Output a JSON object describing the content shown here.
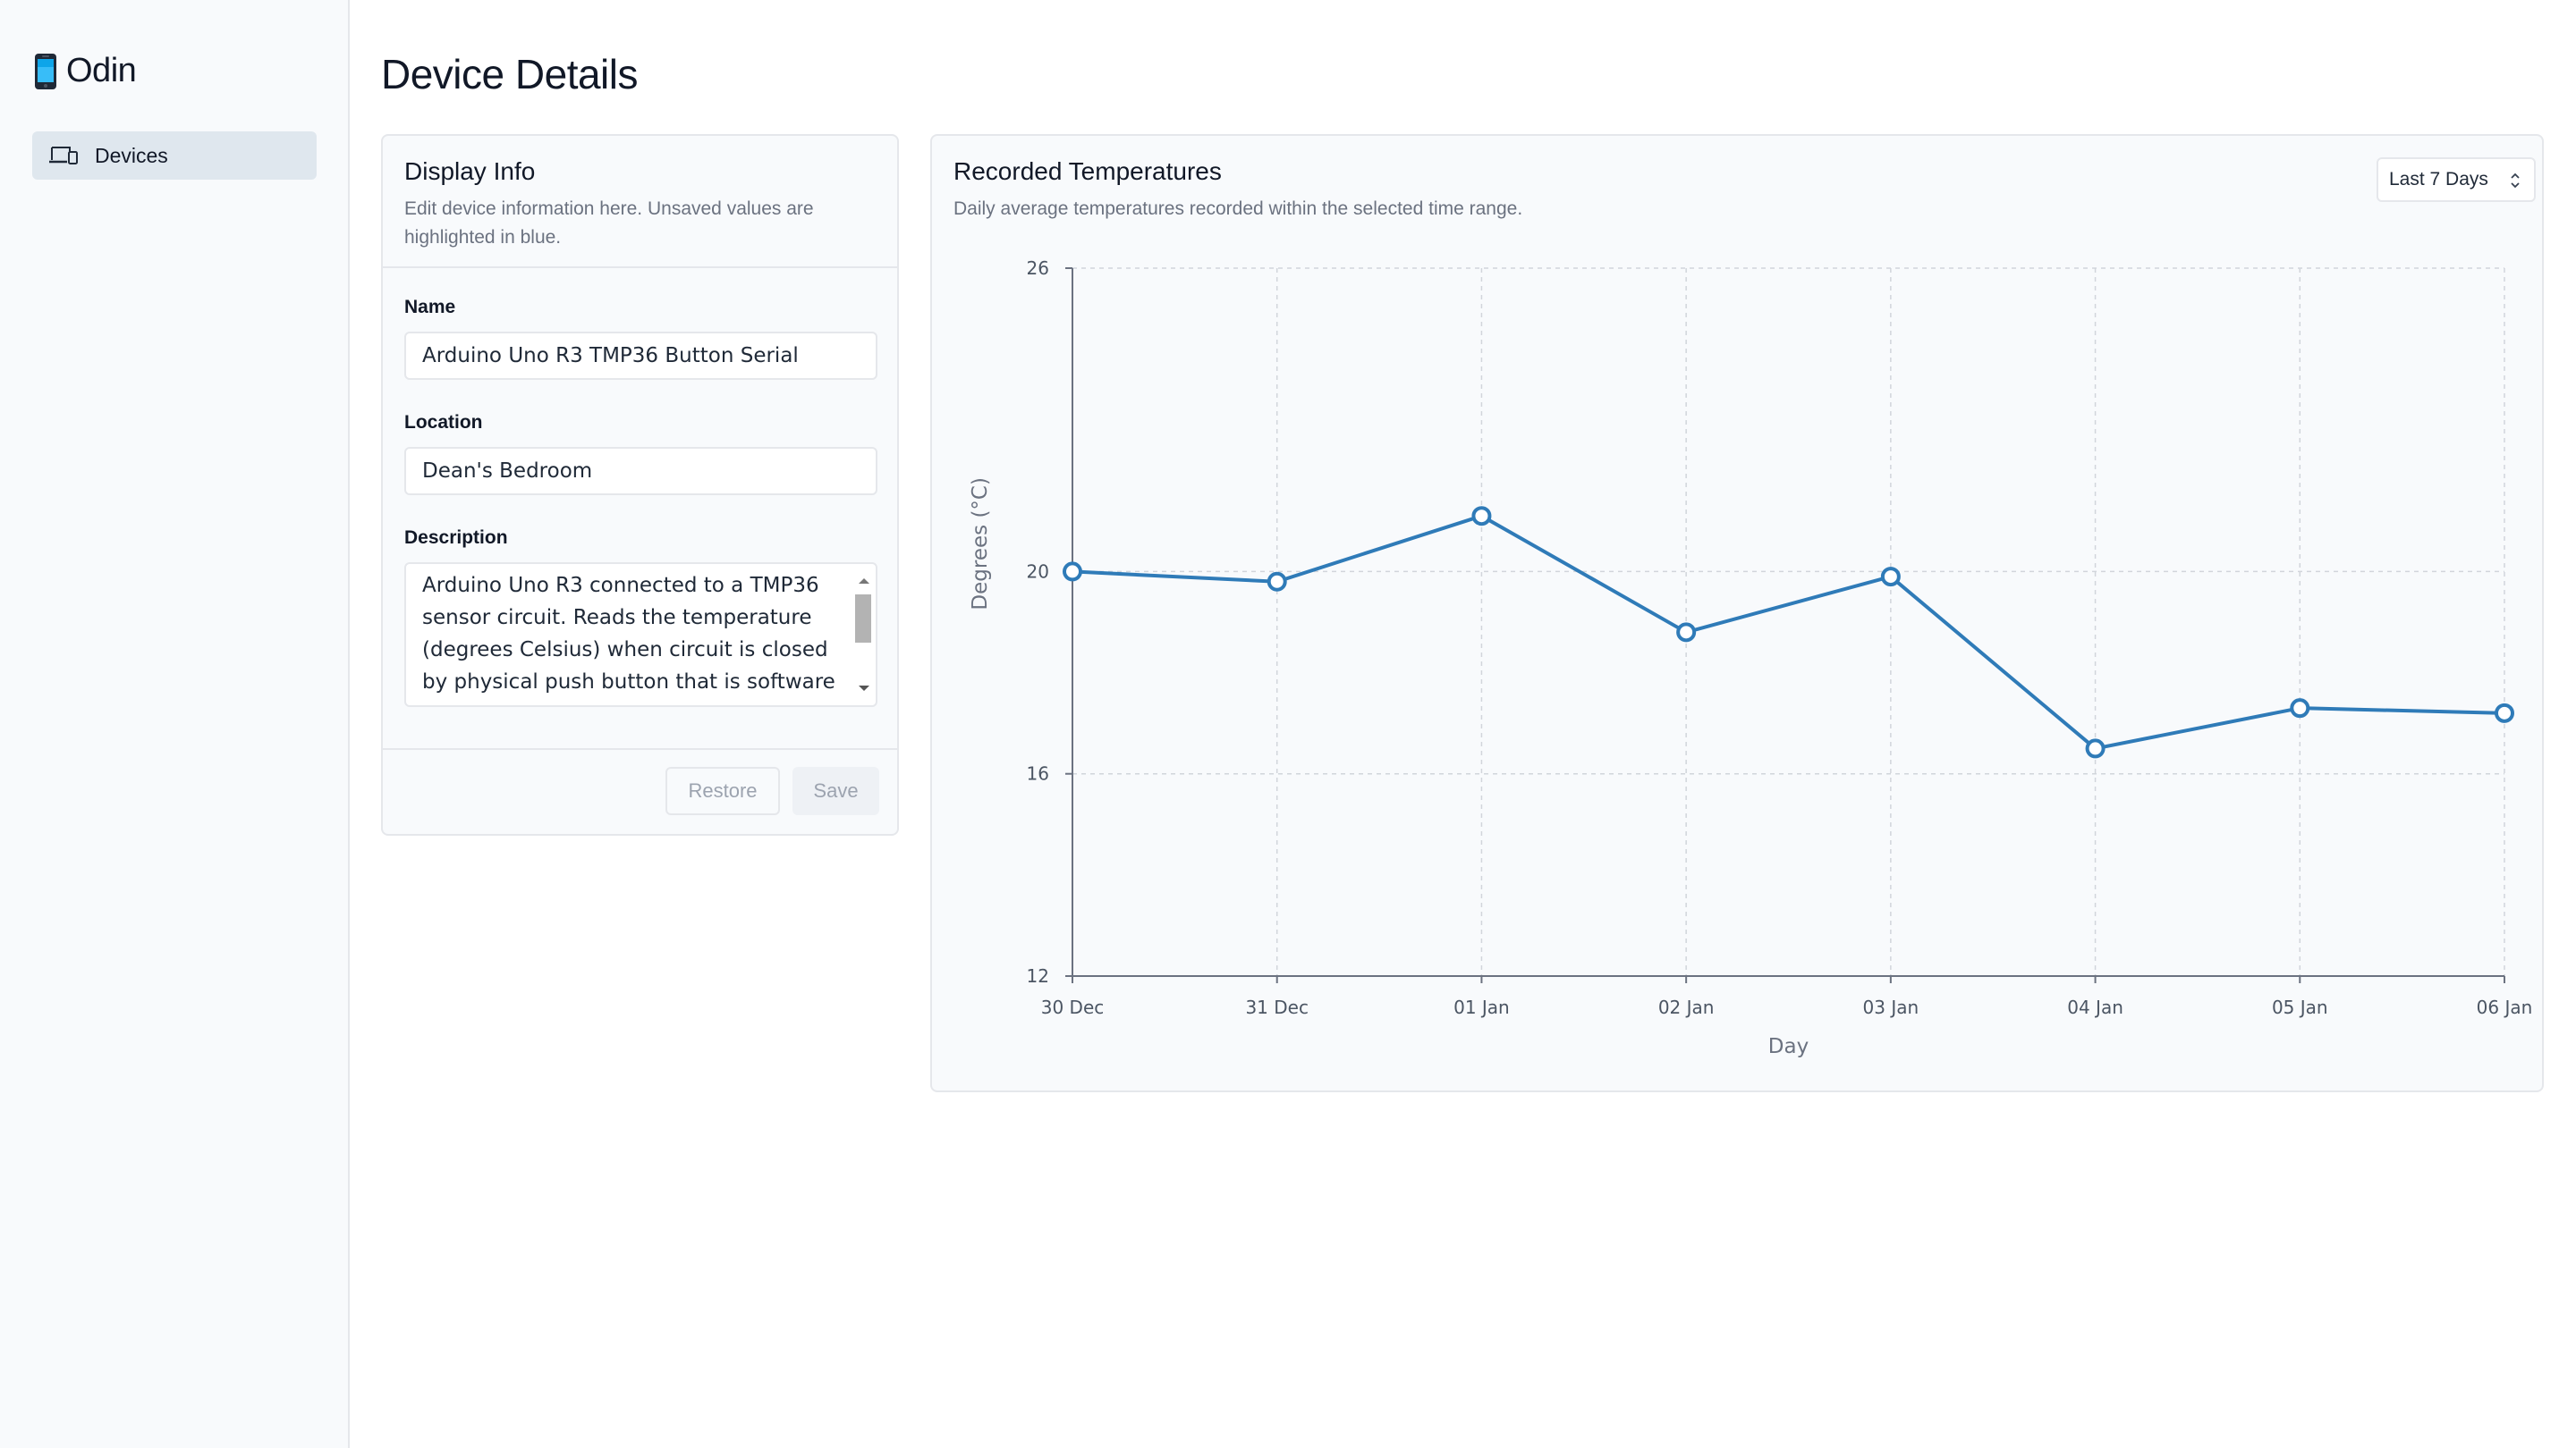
{
  "app": {
    "name": "Odin",
    "icon": "phone-icon"
  },
  "sidebar": {
    "items": [
      {
        "label": "Devices",
        "icon": "devices-icon",
        "active": true
      }
    ]
  },
  "page": {
    "title": "Device Details"
  },
  "display_info": {
    "title": "Display Info",
    "subtitle_line1": "Edit device information here. Unsaved values are",
    "subtitle_line2": "highlighted in blue.",
    "name": {
      "label": "Name",
      "value": "Arduino Uno R3 TMP36 Button Serial"
    },
    "location": {
      "label": "Location",
      "value": "Dean's Bedroom"
    },
    "description": {
      "label": "Description",
      "lines": [
        "Arduino Uno R3 connected to a TMP36",
        "sensor circuit. Reads the temperature",
        "(degrees Celsius) when circuit is closed",
        "by physical push button that is software"
      ]
    },
    "restore_label": "Restore",
    "save_label": "Save"
  },
  "temperatures": {
    "title": "Recorded Temperatures",
    "subtitle": "Daily average temperatures recorded within the selected time range.",
    "range_select": {
      "value": "Last 7 Days",
      "icon": "updown-chevron-icon"
    }
  },
  "colors": {
    "line": "#2f7bb8",
    "active_nav": "#dfe7ee",
    "sidebar_bg": "#f8fafc"
  },
  "chart_data": {
    "type": "line",
    "title": "",
    "categories": [
      "30 Dec",
      "31 Dec",
      "01 Jan",
      "02 Jan",
      "03 Jan",
      "04 Jan",
      "05 Jan",
      "06 Jan"
    ],
    "series": [
      {
        "values": [
          20.0,
          19.8,
          21.1,
          18.8,
          19.9,
          16.5,
          17.3,
          17.2
        ]
      }
    ],
    "xlabel": "Day",
    "ylabel": "Degrees (°C)",
    "ylim": [
      12,
      26
    ],
    "yticks": [
      12,
      16,
      20,
      26
    ],
    "grid": true,
    "markers": "hollow-circle"
  }
}
